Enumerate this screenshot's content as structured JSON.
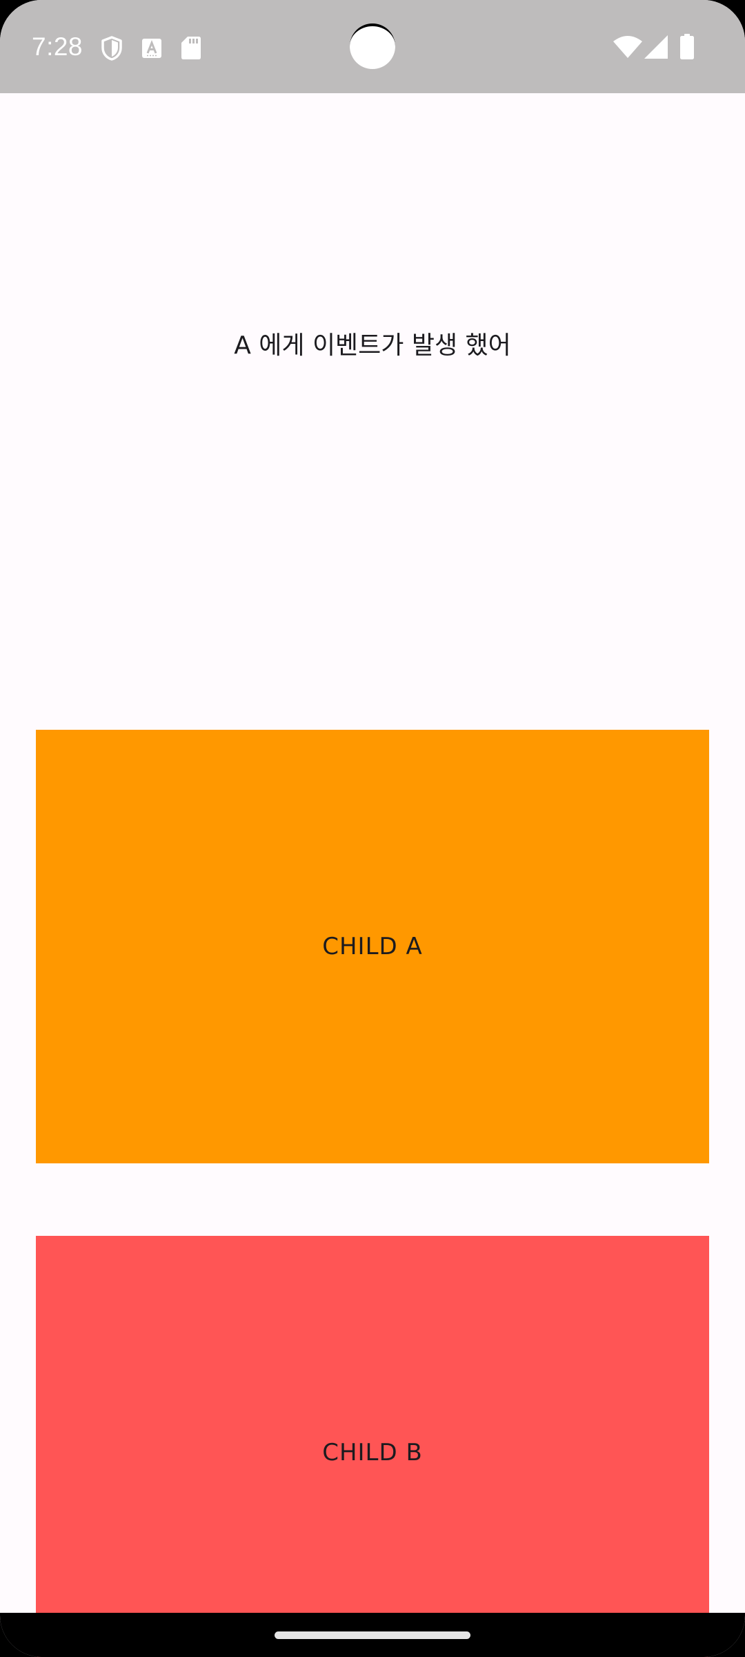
{
  "status_bar": {
    "time": "7:28",
    "left_icons": [
      "shield-icon",
      "font-a-icon",
      "sd-card-icon"
    ],
    "right_icons": [
      "wifi-icon",
      "cellular-signal-icon",
      "battery-icon"
    ],
    "background_color": "#BEBCBC"
  },
  "main": {
    "event_message": "A 에게 이벤트가 발생 했어",
    "children": [
      {
        "label": "CHILD A",
        "color": "#FF9800"
      },
      {
        "label": "CHILD B",
        "color": "#FF5555"
      }
    ],
    "background_color": "#FFFBFE"
  },
  "navigation": {
    "handle": "home-gesture-handle"
  }
}
